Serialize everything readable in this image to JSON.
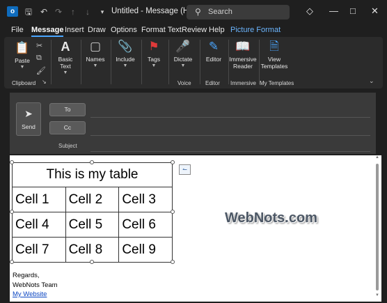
{
  "window": {
    "title": "Untitled - Message (HT...",
    "search_placeholder": "Search",
    "quick_access": [
      "save-icon",
      "undo-icon",
      "redo-icon",
      "up-arrow-icon",
      "down-arrow-icon",
      "customize-icon"
    ]
  },
  "menu": {
    "tabs": [
      "File",
      "Message",
      "Insert",
      "Draw",
      "Options",
      "Format Text",
      "Review",
      "Help",
      "Picture Format"
    ],
    "active": "Message"
  },
  "ribbon": {
    "clipboard": {
      "paste": "Paste",
      "group": "Clipboard"
    },
    "basic_text": {
      "label1": "Basic",
      "label2": "Text"
    },
    "names": {
      "label": "Names"
    },
    "include": {
      "label": "Include"
    },
    "tags": {
      "label": "Tags"
    },
    "voice": {
      "dictate": "Dictate",
      "group": "Voice"
    },
    "editor": {
      "editor": "Editor",
      "group": "Editor"
    },
    "immersive": {
      "label1": "Immersive",
      "label2": "Reader",
      "group": "Immersive"
    },
    "templates": {
      "label1": "View",
      "label2": "Templates",
      "group": "My Templates"
    }
  },
  "compose": {
    "send": "Send",
    "to": "To",
    "cc": "Cc",
    "subject": "Subject"
  },
  "body": {
    "table_title": "This is my table",
    "cells": [
      [
        "Cell 1",
        "Cell 2",
        "Cell 3"
      ],
      [
        "Cell 4",
        "Cell 5",
        "Cell 6"
      ],
      [
        "Cell 7",
        "Cell 8",
        "Cell 9"
      ]
    ],
    "watermark": "WebNots.com",
    "signature": {
      "line1": "Regards,",
      "line2": "WebNots Team",
      "link": "My Website"
    }
  },
  "colors": {
    "accent": "#4aa6ff",
    "picture_format_tab": "#6cb6ff",
    "link": "#0b46c2"
  }
}
